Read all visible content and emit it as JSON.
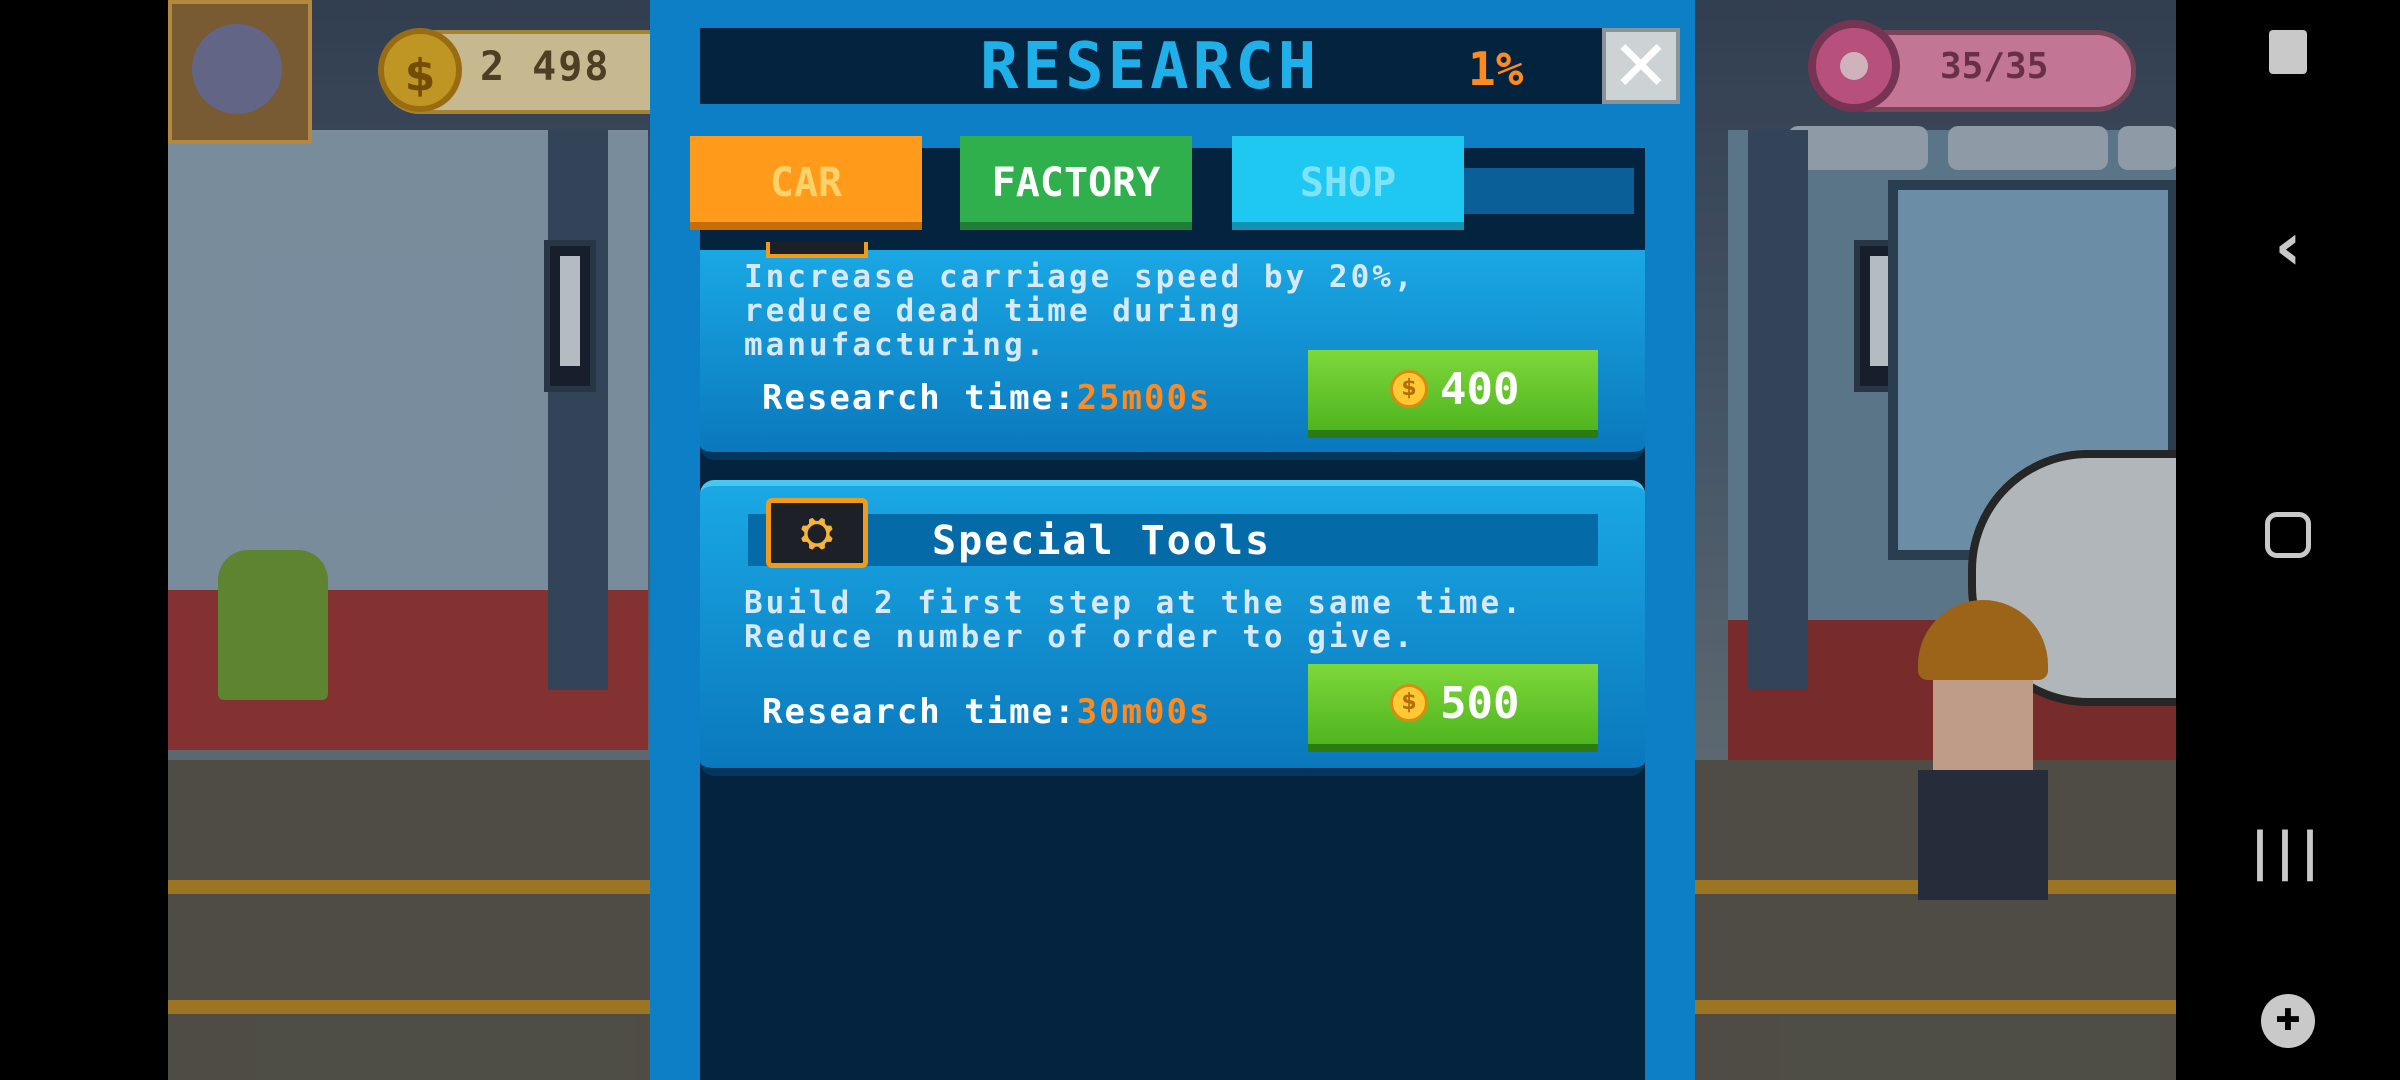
{
  "hud": {
    "coins": "2 498",
    "coin_symbol": "$",
    "donuts": "35/35"
  },
  "panel": {
    "title": "RESEARCH",
    "progress_percent": "1%",
    "close_symbol": "✕",
    "tabs": [
      {
        "label": "CAR",
        "selected": false
      },
      {
        "label": "FACTORY",
        "selected": true
      },
      {
        "label": "SHOP",
        "selected": false
      }
    ],
    "research_items": [
      {
        "name": "",
        "description_lines": [
          "Increase carriage speed by 20%,",
          "reduce dead time during",
          "manufacturing."
        ],
        "time_label": "Research time:",
        "time_value": "25m00s",
        "price": "400"
      },
      {
        "name": "Special Tools",
        "icon": "workers-icon",
        "description_lines": [
          "Build 2 first step at the same time.",
          "Reduce number of order to give."
        ],
        "time_label": "Research time:",
        "time_value": "30m00s",
        "price": "500"
      }
    ]
  },
  "colors": {
    "panel_blue": "#0d7fc7",
    "title_cyan": "#1fb0ea",
    "accent_orange": "#ff8a1e",
    "buy_green": "#4fb51f"
  },
  "nav": {
    "icons": [
      "screenshot-icon",
      "back-icon",
      "home-icon",
      "recents-icon",
      "game-tools-icon"
    ]
  }
}
